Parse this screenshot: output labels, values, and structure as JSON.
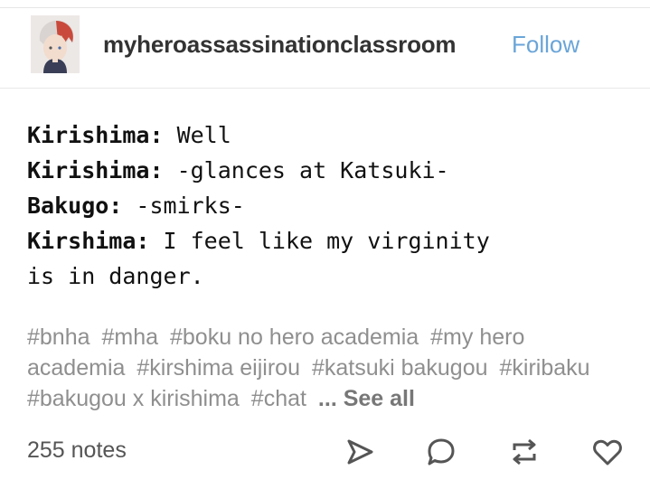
{
  "post": {
    "username": "myheroassassinationclassroom",
    "follow_label": "Follow",
    "lines": [
      {
        "speaker": "Kirishima:",
        "text": " Well"
      },
      {
        "speaker": "Kirishima:",
        "text": " -glances at Katsuki-"
      },
      {
        "speaker": "Bakugo:",
        "text": " -smirks-"
      },
      {
        "speaker": "Kirshima:",
        "text": " I feel like my virginity"
      },
      {
        "speaker": "",
        "text": "is in danger."
      }
    ],
    "tags": [
      "#bnha",
      "#mha",
      "#boku no hero academia",
      "#my hero academia",
      "#kirshima eijirou",
      "#katsuki bakugou",
      "#kiribaku",
      "#bakugou x kirishima",
      "#chat"
    ],
    "see_all_label": "... See all",
    "notes_label": "255 notes"
  },
  "colors": {
    "accent": "#6aa5d8",
    "tag": "#8f8f8f",
    "icon": "#555555"
  },
  "icons": [
    "share-icon",
    "reply-icon",
    "reblog-icon",
    "like-icon"
  ]
}
